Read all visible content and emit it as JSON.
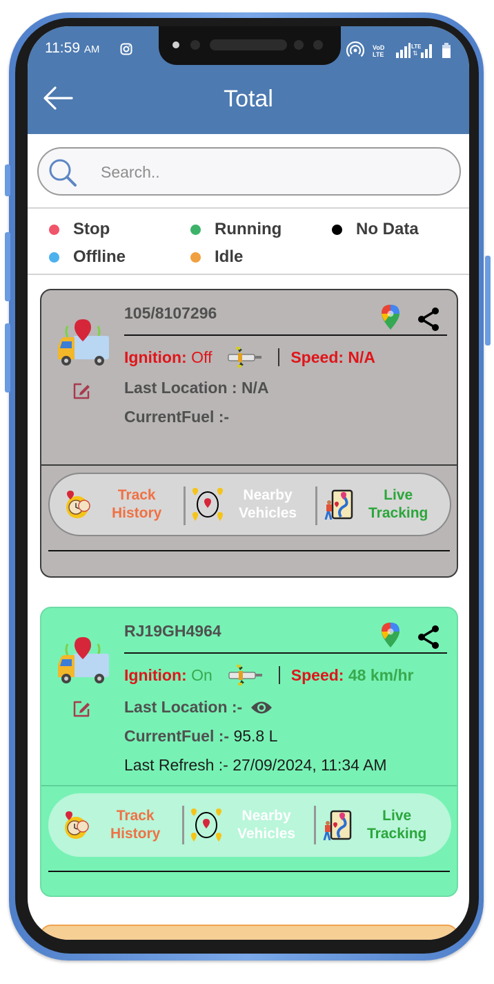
{
  "status_bar": {
    "time": "11:59",
    "ampm": "AM",
    "icons": [
      "instagram-icon",
      "hotspot-icon",
      "volte-icon",
      "signal-icon",
      "lte-icon",
      "signal-icon",
      "battery-icon"
    ],
    "volte_label": "VoLTE",
    "lte_label": "LTE"
  },
  "header": {
    "title": "Total",
    "back_icon": "arrow-left-icon",
    "color": "#4d7ab1"
  },
  "search": {
    "placeholder": "Search..",
    "value": ""
  },
  "legend": [
    {
      "label": "Stop",
      "color": "#f0556a"
    },
    {
      "label": "Running",
      "color": "#3db36a"
    },
    {
      "label": "No Data",
      "color": "#000000"
    },
    {
      "label": "Offline",
      "color": "#4db1ee"
    },
    {
      "label": "Idle",
      "color": "#f0a040"
    }
  ],
  "vehicles": [
    {
      "status": "stop",
      "plate": "105/8107296",
      "ignition_label": "Ignition:",
      "ignition_value": "Off",
      "speed_label": "Speed:",
      "speed_value": "N/A",
      "last_location_label": "Last Location : N/A",
      "current_fuel_label": "CurrentFuel :-",
      "current_fuel_value": "",
      "card_color": "#b9b6b5"
    },
    {
      "status": "running",
      "plate": "RJ19GH4964",
      "ignition_label": "Ignition:",
      "ignition_value": "On",
      "speed_label": "Speed:",
      "speed_value": "48 km/hr",
      "last_location_label": "Last Location :-",
      "current_fuel_label": "CurrentFuel :-",
      "current_fuel_value": "95.8 L",
      "last_refresh": "Last Refresh :- 27/09/2024, 11:34 AM",
      "card_color": "#77f2b4"
    },
    {
      "status": "idle",
      "card_color": "#f6cf95"
    }
  ],
  "actions": {
    "track_history": {
      "line1": "Track",
      "line2": "History",
      "color": "#ef7144"
    },
    "nearby_vehicles": {
      "line1": "Nearby",
      "line2": "Vehicles",
      "color": "#ffffff"
    },
    "live_tracking": {
      "line1": "Live",
      "line2": "Tracking",
      "color": "#2aa63b"
    }
  }
}
